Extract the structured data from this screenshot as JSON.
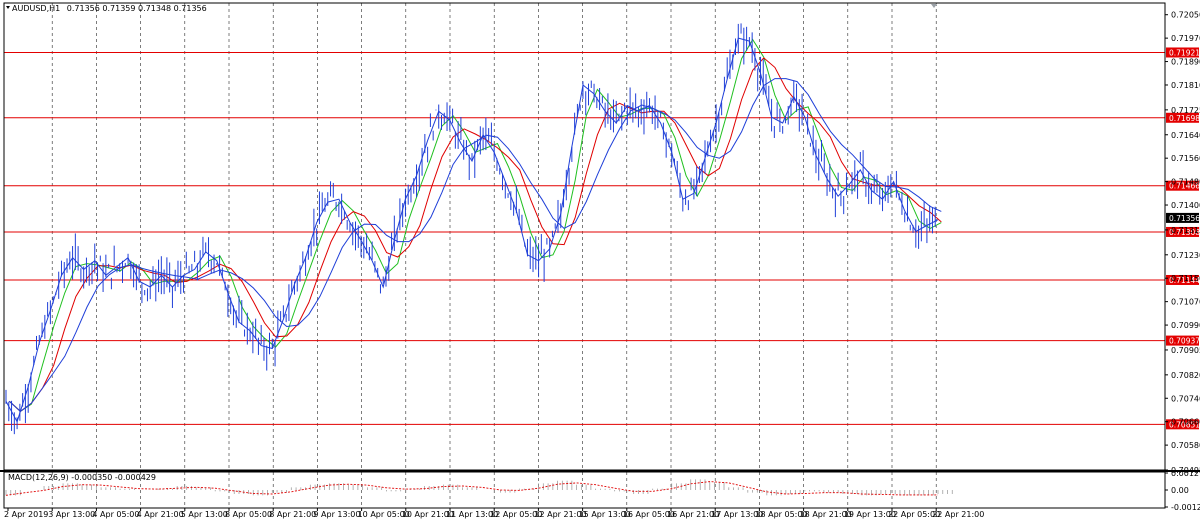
{
  "chart_data": {
    "type": "line",
    "main_header": {
      "symbol": "AUDUSD,H1",
      "ohlc": "0.71356 0.71359 0.71348 0.71356"
    },
    "price_axis": {
      "labels": [
        "0.72050",
        "0.71970",
        "0.71890",
        "0.71810",
        "0.71725",
        "0.71640",
        "0.71560",
        "0.71480",
        "0.71400",
        "0.71315",
        "0.71230",
        "0.71150",
        "0.71070",
        "0.70990",
        "0.70905",
        "0.70820",
        "0.70740",
        "0.70660",
        "0.70580",
        "0.70495"
      ],
      "ylim": [
        0.70495,
        0.7209
      ]
    },
    "time_axis": {
      "labels": [
        "2 Apr 2019",
        "3 Apr 13:00",
        "4 Apr 05:00",
        "4 Apr 21:00",
        "5 Apr 13:00",
        "8 Apr 05:00",
        "8 Apr 21:00",
        "9 Apr 13:00",
        "10 Apr 05:00",
        "10 Apr 21:00",
        "11 Apr 13:00",
        "12 Apr 05:00",
        "12 Apr 21:00",
        "15 Apr 13:00",
        "16 Apr 05:00",
        "16 Apr 21:00",
        "17 Apr 13:00",
        "18 Apr 05:00",
        "18 Apr 21:00",
        "19 Apr 13:00",
        "22 Apr 05:00",
        "22 Apr 21:00"
      ]
    },
    "horizontal_levels": [
      {
        "value": 0.71921,
        "label": "0.71921"
      },
      {
        "value": 0.71698,
        "label": "0.71698"
      },
      {
        "value": 0.71466,
        "label": "0.71466"
      },
      {
        "value": 0.71308,
        "label": "0.71308"
      },
      {
        "value": 0.71144,
        "label": "0.71144"
      },
      {
        "value": 0.70937,
        "label": "0.70937"
      },
      {
        "value": 0.70651,
        "label": "0.70651"
      }
    ],
    "current_price": {
      "value": 0.71356,
      "label": "0.71356"
    },
    "price_series": {
      "color": "#1f3fd8",
      "values": [
        0.7073,
        0.7066,
        0.7078,
        0.7093,
        0.7104,
        0.7116,
        0.7122,
        0.7118,
        0.7121,
        0.7116,
        0.7119,
        0.7122,
        0.7114,
        0.7112,
        0.7116,
        0.7112,
        0.7116,
        0.7118,
        0.7124,
        0.7121,
        0.711,
        0.71,
        0.7097,
        0.7092,
        0.7091,
        0.7101,
        0.7113,
        0.7122,
        0.7134,
        0.7141,
        0.7142,
        0.7134,
        0.7128,
        0.7121,
        0.7112,
        0.7128,
        0.7142,
        0.715,
        0.7162,
        0.7172,
        0.7169,
        0.7161,
        0.7155,
        0.7164,
        0.7158,
        0.7148,
        0.7138,
        0.7123,
        0.7121,
        0.7125,
        0.7137,
        0.716,
        0.7181,
        0.7178,
        0.7172,
        0.7168,
        0.7174,
        0.7172,
        0.7174,
        0.7168,
        0.7158,
        0.7142,
        0.7144,
        0.7156,
        0.7168,
        0.7183,
        0.7197,
        0.7196,
        0.7185,
        0.717,
        0.7168,
        0.7177,
        0.717,
        0.7157,
        0.7149,
        0.7143,
        0.7147,
        0.7152,
        0.7145,
        0.7142,
        0.7148,
        0.7138,
        0.7131,
        0.7133,
        0.7135
      ]
    },
    "moving_averages": [
      {
        "color": "#20c020",
        "period": 5
      },
      {
        "color": "#e00000",
        "period": 10
      },
      {
        "color": "#1f3fd8",
        "period": 20
      }
    ],
    "macd": {
      "header": "MACD(12,26,9) -0.000350 -0.000429",
      "axis_labels": [
        "0.001279",
        "0.00",
        "-0.001279"
      ],
      "ylim": [
        -0.001279,
        0.001279
      ],
      "values": [
        -0.0004,
        0.0,
        0.0003,
        0.0005,
        0.0004,
        0.0002,
        0.0001,
        0.0,
        0.0001,
        0.0003,
        0.0002,
        -0.0001,
        -0.0003,
        -0.0004,
        -0.0002,
        0.0002,
        0.0004,
        0.0005,
        0.0004,
        0.0002,
        -0.0001,
        0.0001,
        0.0003,
        0.0004,
        0.0002,
        0.0,
        -0.0002,
        0.0001,
        0.0005,
        0.0007,
        0.0004,
        0.0001,
        -0.0001,
        -0.0003,
        0.0001,
        0.0005,
        0.0008,
        0.0006,
        0.0002,
        -0.0002,
        -0.0004,
        -0.0003,
        -0.0001,
        -0.0002,
        -0.0003,
        -0.0004,
        -0.0003,
        -0.0004,
        -0.0004,
        -0.0003
      ],
      "signal_color": "#e00000",
      "histogram_color": "#a0a0a0"
    }
  }
}
